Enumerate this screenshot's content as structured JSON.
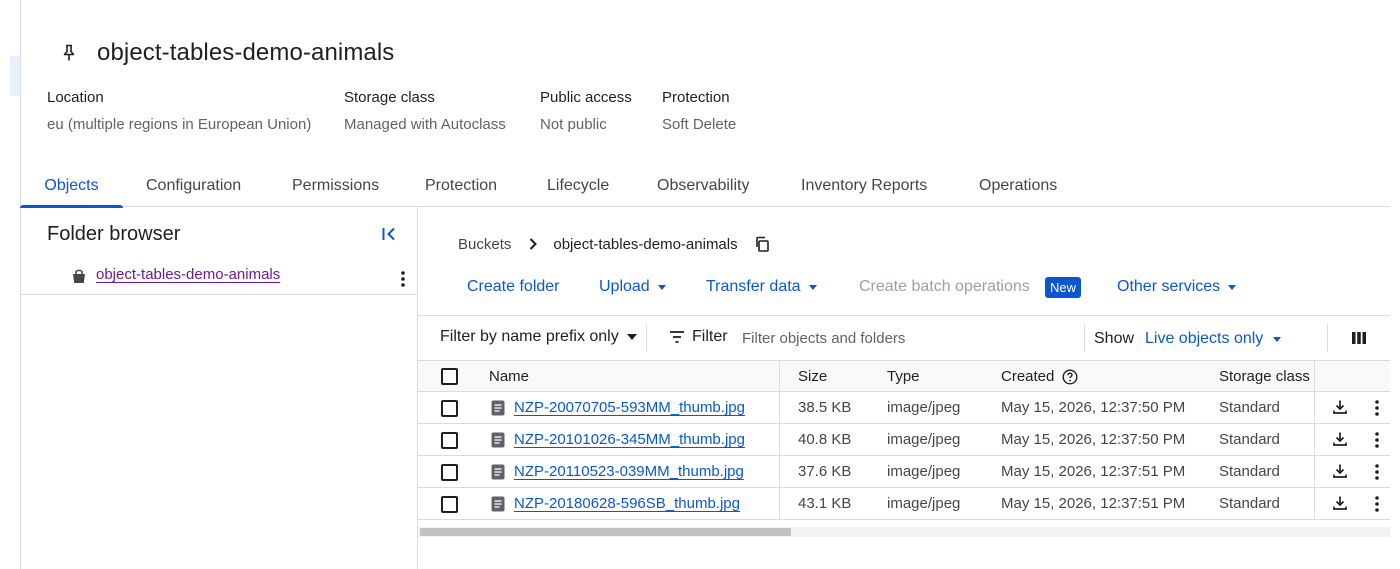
{
  "bucket": {
    "name": "object-tables-demo-animals",
    "meta": [
      {
        "label": "Location",
        "value": "eu (multiple regions in European Union)"
      },
      {
        "label": "Storage class",
        "value": "Managed with Autoclass"
      },
      {
        "label": "Public access",
        "value": "Not public"
      },
      {
        "label": "Protection",
        "value": "Soft Delete"
      }
    ]
  },
  "tabs": [
    {
      "label": "Objects",
      "active": true
    },
    {
      "label": "Configuration"
    },
    {
      "label": "Permissions"
    },
    {
      "label": "Protection"
    },
    {
      "label": "Lifecycle"
    },
    {
      "label": "Observability"
    },
    {
      "label": "Inventory Reports"
    },
    {
      "label": "Operations"
    }
  ],
  "folder_browser": {
    "title": "Folder browser",
    "items": [
      {
        "label": "object-tables-demo-animals"
      }
    ]
  },
  "breadcrumb": {
    "root": "Buckets",
    "current": "object-tables-demo-animals"
  },
  "actions": {
    "create_folder": "Create folder",
    "upload": "Upload",
    "transfer_data": "Transfer data",
    "create_batch": "Create batch operations",
    "new_badge": "New",
    "other_services": "Other services"
  },
  "filter": {
    "prefix_mode": "Filter by name prefix only",
    "filter_label": "Filter",
    "placeholder": "Filter objects and folders",
    "show_label": "Show",
    "show_value": "Live objects only"
  },
  "table": {
    "columns": {
      "name": "Name",
      "size": "Size",
      "type": "Type",
      "created": "Created",
      "storage_class": "Storage class"
    },
    "rows": [
      {
        "name": "NZP-20070705-593MM_thumb.jpg",
        "size": "38.5 KB",
        "type": "image/jpeg",
        "created": "May 15, 2026, 12:37:50 PM",
        "storage_class": "Standard"
      },
      {
        "name": "NZP-20101026-345MM_thumb.jpg",
        "size": "40.8 KB",
        "type": "image/jpeg",
        "created": "May 15, 2026, 12:37:50 PM",
        "storage_class": "Standard"
      },
      {
        "name": "NZP-20110523-039MM_thumb.jpg",
        "size": "37.6 KB",
        "type": "image/jpeg",
        "created": "May 15, 2026, 12:37:51 PM",
        "storage_class": "Standard"
      },
      {
        "name": "NZP-20180628-596SB_thumb.jpg",
        "size": "43.1 KB",
        "type": "image/jpeg",
        "created": "May 15, 2026, 12:37:51 PM",
        "storage_class": "Standard"
      }
    ]
  },
  "icons": {
    "pin": "pin-icon",
    "collapse": "collapse-panel-icon",
    "bucket": "bucket-icon",
    "copy": "copy-icon",
    "filter": "filter-icon",
    "columns": "column-display-icon",
    "file": "file-icon",
    "download": "download-icon",
    "more": "more-vert-icon",
    "help": "help-icon"
  },
  "colors": {
    "accent": "#0b57d0",
    "visited_link": "#6a1b9a",
    "divider": "#dadce0",
    "muted_text": "#5f6368"
  }
}
